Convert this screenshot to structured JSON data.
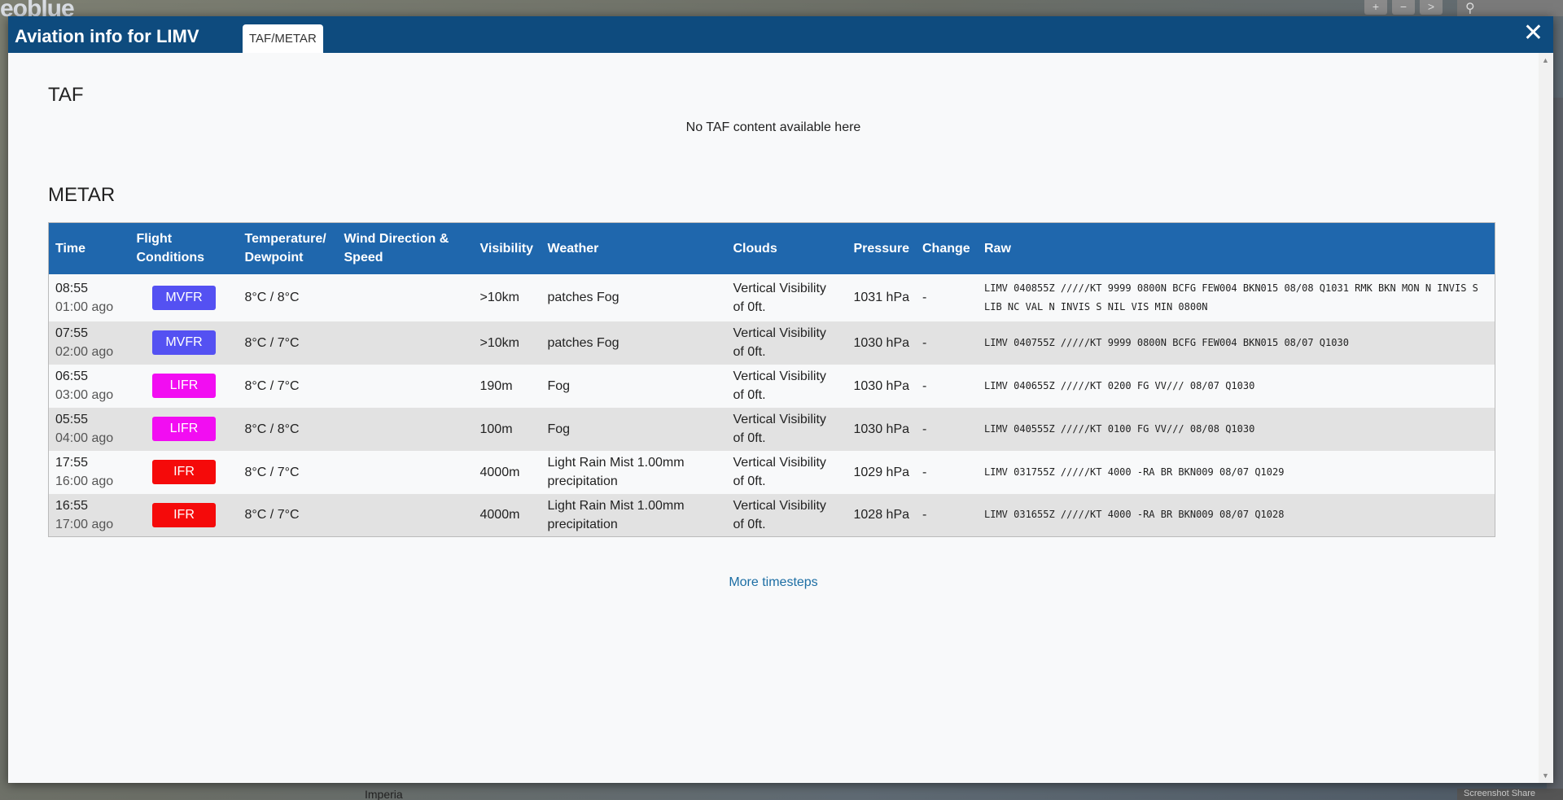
{
  "background": {
    "logo": "eoblue",
    "zoom_buttons": [
      "+",
      "−",
      ">"
    ],
    "place_label": "Imperia",
    "footer_text": "Screenshot  Share"
  },
  "modal": {
    "title": "Aviation info for LIMV",
    "tab": "TAF/METAR",
    "close_label": "✕"
  },
  "taf": {
    "heading": "TAF",
    "empty_message": "No TAF content available here"
  },
  "metar": {
    "heading": "METAR",
    "columns": [
      "Time",
      "Flight Conditions",
      "Temperature/ Dewpoint",
      "Wind Direction & Speed",
      "Visibility",
      "Weather",
      "Clouds",
      "Pressure",
      "Change",
      "Raw"
    ],
    "rows": [
      {
        "time": "08:55",
        "ago": "01:00 ago",
        "fc": "MVFR",
        "fc_color": "#5451f2",
        "temp": "8°C / 8°C",
        "wind": "",
        "vis": ">10km",
        "weather": "patches Fog",
        "clouds": "Vertical Visibility of 0ft.",
        "pressure": "1031 hPa",
        "change": "-",
        "raw": "LIMV 040855Z /////KT 9999 0800N BCFG FEW004 BKN015 08/08 Q1031 RMK BKN MON N INVIS S LIB NC VAL N INVIS S NIL VIS MIN 0800N"
      },
      {
        "time": "07:55",
        "ago": "02:00 ago",
        "fc": "MVFR",
        "fc_color": "#5451f2",
        "temp": "8°C / 7°C",
        "wind": "",
        "vis": ">10km",
        "weather": "patches Fog",
        "clouds": "Vertical Visibility of 0ft.",
        "pressure": "1030 hPa",
        "change": "-",
        "raw": "LIMV 040755Z /////KT 9999 0800N BCFG FEW004 BKN015 08/07 Q1030"
      },
      {
        "time": "06:55",
        "ago": "03:00 ago",
        "fc": "LIFR",
        "fc_color": "#f20df2",
        "temp": "8°C / 7°C",
        "wind": "",
        "vis": "190m",
        "weather": "Fog",
        "clouds": "Vertical Visibility of 0ft.",
        "pressure": "1030 hPa",
        "change": "-",
        "raw": "LIMV 040655Z /////KT 0200 FG VV/// 08/07 Q1030"
      },
      {
        "time": "05:55",
        "ago": "04:00 ago",
        "fc": "LIFR",
        "fc_color": "#f20df2",
        "temp": "8°C / 8°C",
        "wind": "",
        "vis": "100m",
        "weather": "Fog",
        "clouds": "Vertical Visibility of 0ft.",
        "pressure": "1030 hPa",
        "change": "-",
        "raw": "LIMV 040555Z /////KT 0100 FG VV/// 08/08 Q1030"
      },
      {
        "time": "17:55",
        "ago": "16:00 ago",
        "fc": "IFR",
        "fc_color": "#f50a0a",
        "temp": "8°C / 7°C",
        "wind": "",
        "vis": "4000m",
        "weather": "Light Rain Mist 1.00mm precipitation",
        "clouds": "Vertical Visibility of 0ft.",
        "pressure": "1029 hPa",
        "change": "-",
        "raw": "LIMV 031755Z /////KT 4000 -RA BR BKN009 08/07 Q1029"
      },
      {
        "time": "16:55",
        "ago": "17:00 ago",
        "fc": "IFR",
        "fc_color": "#f50a0a",
        "temp": "8°C / 7°C",
        "wind": "",
        "vis": "4000m",
        "weather": "Light Rain Mist 1.00mm precipitation",
        "clouds": "Vertical Visibility of 0ft.",
        "pressure": "1028 hPa",
        "change": "-",
        "raw": "LIMV 031655Z /////KT 4000 -RA BR BKN009 08/07 Q1028"
      }
    ],
    "more_label": "More timesteps"
  }
}
